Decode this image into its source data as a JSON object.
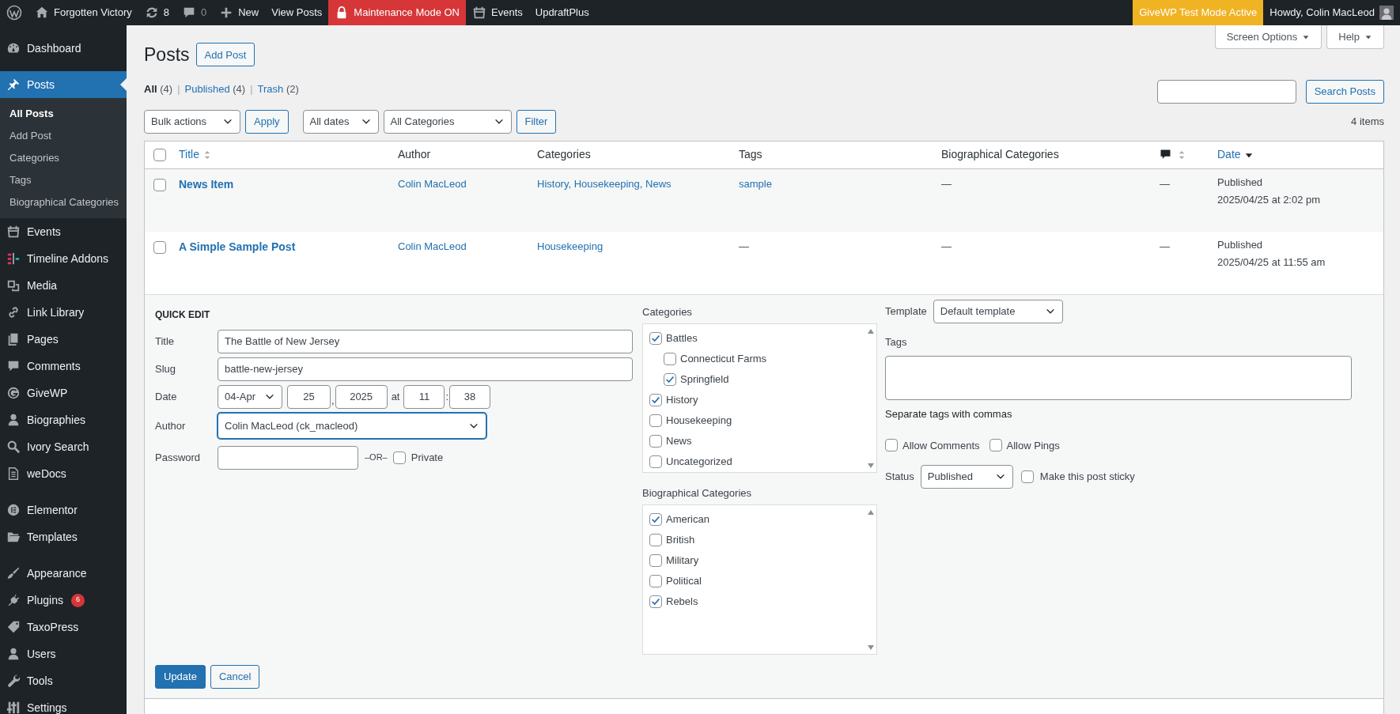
{
  "admin_bar": {
    "left": [
      {
        "kind": "logo"
      },
      {
        "kind": "home",
        "label": "Forgotten Victory"
      },
      {
        "kind": "updates",
        "label": "8"
      },
      {
        "kind": "comments",
        "label": "0"
      },
      {
        "kind": "new",
        "label": "New"
      },
      {
        "kind": "plain",
        "label": "View Posts"
      },
      {
        "kind": "maintenance",
        "label": "Maintenance Mode ON"
      },
      {
        "kind": "events",
        "label": "Events"
      },
      {
        "kind": "plain",
        "label": "UpdraftPlus"
      }
    ],
    "right": [
      {
        "kind": "givewp",
        "label": "GiveWP Test Mode Active"
      },
      {
        "kind": "account",
        "label": "Howdy, Colin MacLeod"
      }
    ]
  },
  "sidebar": {
    "groups": [
      {
        "items": [
          {
            "kind": "dashboard",
            "label": "Dashboard",
            "selected": false
          }
        ]
      },
      {
        "items": [
          {
            "kind": "posts",
            "label": "Posts",
            "selected": true,
            "children": [
              {
                "label": "All Posts",
                "selected": true
              },
              {
                "label": "Add Post",
                "selected": false
              },
              {
                "label": "Categories",
                "selected": false
              },
              {
                "label": "Tags",
                "selected": false
              },
              {
                "label": "Biographical Categories",
                "selected": false
              }
            ]
          },
          {
            "kind": "events",
            "label": "Events",
            "selected": false
          },
          {
            "kind": "timeline",
            "label": "Timeline Addons",
            "selected": false
          },
          {
            "kind": "media",
            "label": "Media",
            "selected": false
          },
          {
            "kind": "link",
            "label": "Link Library",
            "selected": false
          },
          {
            "kind": "pages",
            "label": "Pages",
            "selected": false
          },
          {
            "kind": "comments",
            "label": "Comments",
            "selected": false
          },
          {
            "kind": "givewp",
            "label": "GiveWP",
            "selected": false
          },
          {
            "kind": "person",
            "label": "Biographies",
            "selected": false
          },
          {
            "kind": "search",
            "label": "Ivory Search",
            "selected": false
          },
          {
            "kind": "docs",
            "label": "weDocs",
            "selected": false
          }
        ]
      },
      {
        "items": [
          {
            "kind": "elementor",
            "label": "Elementor",
            "selected": false
          },
          {
            "kind": "templates",
            "label": "Templates",
            "selected": false
          }
        ]
      },
      {
        "items": [
          {
            "kind": "appearance",
            "label": "Appearance",
            "selected": false
          },
          {
            "kind": "plugins",
            "label": "Plugins",
            "selected": false,
            "badge": "6"
          },
          {
            "kind": "taxopress",
            "label": "TaxoPress",
            "selected": false
          },
          {
            "kind": "person",
            "label": "Users",
            "selected": false
          },
          {
            "kind": "tools",
            "label": "Tools",
            "selected": false
          },
          {
            "kind": "settings",
            "label": "Settings",
            "selected": false
          }
        ]
      }
    ]
  },
  "header": {
    "title": "Posts",
    "add_button": "Add Post",
    "screen_options": "Screen Options",
    "help": "Help"
  },
  "views": [
    {
      "label": "All",
      "count": "(4)",
      "selected": true
    },
    {
      "separator": "|",
      "label": "Published",
      "count": "(4)",
      "selected": false
    },
    {
      "separator": "|",
      "label": "Trash",
      "count": "(2)",
      "selected": false
    }
  ],
  "search": {
    "button": "Search Posts"
  },
  "filters": {
    "bulk": "Bulk actions",
    "apply": "Apply",
    "dates": "All dates",
    "categories": "All Categories",
    "filter": "Filter",
    "count": "4 items"
  },
  "table": {
    "select_all_checked": false,
    "columns": [
      {
        "kind": "text",
        "label": "Title",
        "sortable": true,
        "sorted": false
      },
      {
        "kind": "text",
        "label": "Author",
        "sortable": false
      },
      {
        "kind": "text",
        "label": "Categories",
        "sortable": false
      },
      {
        "kind": "text",
        "label": "Tags",
        "sortable": false
      },
      {
        "kind": "text",
        "label": "Biographical Categories",
        "sortable": false
      },
      {
        "kind": "comments",
        "sortable": true,
        "sorted": false
      },
      {
        "kind": "text",
        "label": "Date",
        "sortable": true,
        "sorted": true
      }
    ],
    "rows": [
      {
        "checked": false,
        "title": "News Item",
        "author": "Colin MacLeod",
        "categories": "History, Housekeeping, News",
        "tags": {
          "text": "sample",
          "link": true
        },
        "bio_categories": "—",
        "comments": "—",
        "status": "Published",
        "date": "2025/04/25 at 2:02 pm"
      },
      {
        "checked": false,
        "title": "A Simple Sample Post",
        "author": "Colin MacLeod",
        "categories": "Housekeeping",
        "tags": {
          "text": "—",
          "link": false
        },
        "bio_categories": "—",
        "comments": "—",
        "status": "Published",
        "date": "2025/04/25 at 11:55 am"
      }
    ]
  },
  "quick_edit": {
    "heading": "QUICK EDIT",
    "title": {
      "label": "Title",
      "value": "The Battle of New Jersey"
    },
    "slug": {
      "label": "Slug",
      "value": "battle-new-jersey"
    },
    "date": {
      "label": "Date",
      "month": "04-Apr",
      "day": "25",
      "sep1": ",",
      "year": "2025",
      "at": "at",
      "hour": "11",
      "sep2": ":",
      "minute": "38"
    },
    "author": {
      "label": "Author",
      "value": "Colin MacLeod (ck_macleod)",
      "focused": true
    },
    "password": {
      "label": "Password",
      "or": "–OR–",
      "private": {
        "label": "Private",
        "checked": false
      }
    },
    "categories": {
      "label": "Categories",
      "items": [
        {
          "label": "Battles",
          "checked": true,
          "children": [
            {
              "label": "Connecticut Farms",
              "checked": false
            },
            {
              "label": "Springfield",
              "checked": true
            }
          ]
        },
        {
          "label": "History",
          "checked": true
        },
        {
          "label": "Housekeeping",
          "checked": false
        },
        {
          "label": "News",
          "checked": false
        },
        {
          "label": "Uncategorized",
          "checked": false
        }
      ]
    },
    "bio_categories": {
      "label": "Biographical Categories",
      "items": [
        {
          "label": "American",
          "checked": true
        },
        {
          "label": "British",
          "checked": false
        },
        {
          "label": "Military",
          "checked": false
        },
        {
          "label": "Political",
          "checked": false
        },
        {
          "label": "Rebels",
          "checked": true
        }
      ]
    },
    "template": {
      "label": "Template",
      "value": "Default template"
    },
    "tags": {
      "label": "Tags",
      "hint": "Separate tags with commas"
    },
    "allow_comments": {
      "label": "Allow Comments",
      "checked": false
    },
    "allow_pings": {
      "label": "Allow Pings",
      "checked": false
    },
    "status": {
      "label": "Status",
      "value": "Published"
    },
    "sticky": {
      "label": "Make this post sticky",
      "checked": false
    },
    "update": "Update",
    "cancel": "Cancel"
  }
}
